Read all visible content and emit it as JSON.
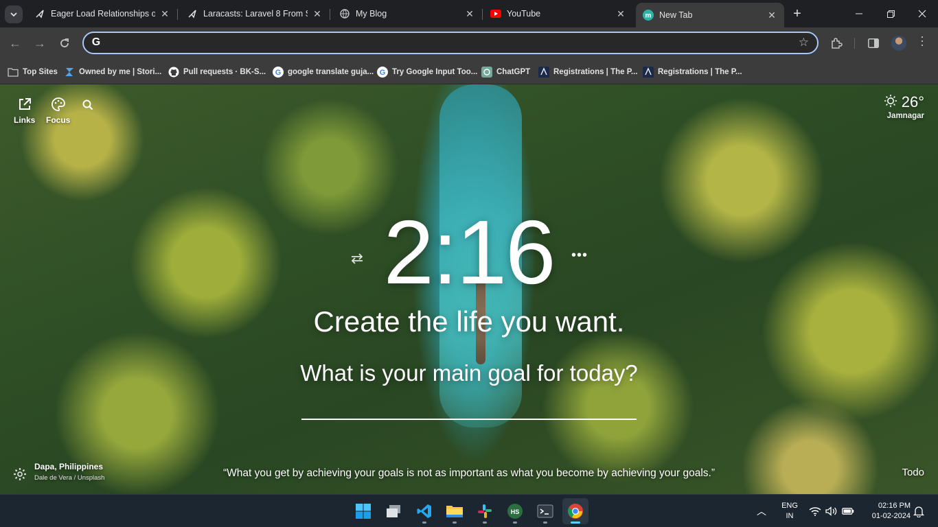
{
  "browser": {
    "tabs": [
      {
        "title": "Eager Load Relationships on",
        "favicon": "laracasts-icon",
        "active": false
      },
      {
        "title": "Laracasts: Laravel 8 From Scr",
        "favicon": "laracasts-icon",
        "active": false
      },
      {
        "title": "My Blog",
        "favicon": "globe-icon",
        "active": false
      },
      {
        "title": "YouTube",
        "favicon": "youtube-icon",
        "active": false
      },
      {
        "title": "New Tab",
        "favicon": "momentum-icon",
        "active": true
      }
    ],
    "omnibox": {
      "value": "",
      "placeholder": ""
    },
    "bookmarks": [
      {
        "label": "Top Sites",
        "icon": "folder-icon"
      },
      {
        "label": "Owned by me | Stori...",
        "icon": "storybook-icon"
      },
      {
        "label": "Pull requests · BK-S...",
        "icon": "github-icon"
      },
      {
        "label": "google translate guja...",
        "icon": "google-icon"
      },
      {
        "label": "Try Google Input Too...",
        "icon": "google-icon"
      },
      {
        "label": "ChatGPT",
        "icon": "chatgpt-icon"
      },
      {
        "label": "Registrations | The P...",
        "icon": "site-icon"
      },
      {
        "label": "Registrations | The P...",
        "icon": "site-icon"
      }
    ]
  },
  "momentum": {
    "links_label": "Links",
    "focus_label": "Focus",
    "weather": {
      "temp": "26°",
      "location": "Jamnagar"
    },
    "clock": "2:16",
    "mantra": "Create the life you want.",
    "focus_question": "What is your main goal for today?",
    "photo": {
      "place": "Dapa, Philippines",
      "credit": "Dale de Vera / Unsplash"
    },
    "quote": "“What you get by achieving your goals is not as important as what you become by achieving your goals.”",
    "todo_label": "Todo"
  },
  "taskbar": {
    "apps": [
      "windows-start-icon",
      "task-view-icon",
      "vscode-icon",
      "file-explorer-icon",
      "slack-icon",
      "hubstaff-icon",
      "terminal-icon",
      "chrome-icon"
    ],
    "lang_line1": "ENG",
    "lang_line2": "IN",
    "time": "02:16 PM",
    "date": "01-02-2024"
  },
  "colors": {
    "accent": "#a8c7fa",
    "taskbar_indicator": "#60cdff",
    "youtube": "#ff0000",
    "momentum": "#2db3a6"
  }
}
